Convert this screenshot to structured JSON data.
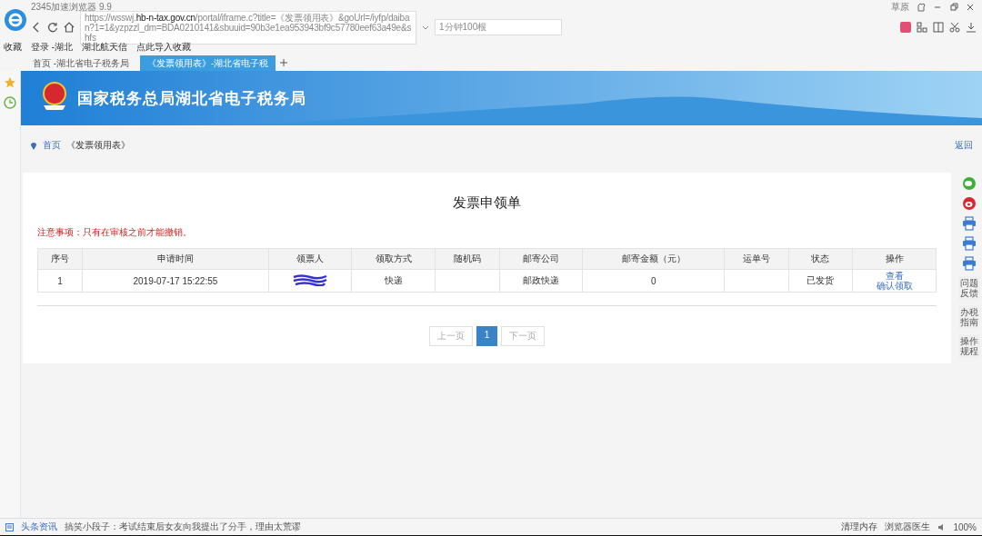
{
  "browser": {
    "title": "2345加速浏览器 9.9",
    "url_host": "https://wsswj.",
    "url_domain": "hb-n-tax.gov.cn",
    "url_rest": "/portal/iframe.c?title=《发票领用表》&goUrl=/iyfp/daiban?1=1&yzpzzl_dm=BDA0210141&sbuuid=90b3e1ea953943bf9c57780eef63a49e&shfs",
    "search_value": "1分钟100根",
    "top_link": "草原"
  },
  "bookmarks": [
    "收藏",
    "登录 -湖北",
    "湖北航天信",
    "点此导入收藏"
  ],
  "tabs": [
    {
      "label": "首页 -湖北省电子税务局",
      "selected": false
    },
    {
      "label": "《发票领用表》-湖北省电子税",
      "selected": true
    }
  ],
  "banner": {
    "title": "国家税务总局湖北省电子税务局"
  },
  "breadcrumb": {
    "home": "首页",
    "current": "《发票领用表》",
    "back": "返回"
  },
  "page_title": "发票申领单",
  "notice": "注意事项：只有在审核之前才能撤销。",
  "table": {
    "columns": [
      "序号",
      "申请时间",
      "领票人",
      "领取方式",
      "随机码",
      "邮寄公司",
      "邮寄金额（元）",
      "运单号",
      "状态",
      "操作"
    ],
    "rows": [
      {
        "cells": [
          "1",
          "2019-07-17 15:22:55",
          "",
          "快递",
          "",
          "邮政快递",
          "0",
          "",
          "已发货"
        ],
        "actions": [
          "查看",
          "确认领取"
        ]
      }
    ]
  },
  "pagination": [
    {
      "label": "上一页",
      "selected": false
    },
    {
      "label": "1",
      "selected": true
    },
    {
      "label": "下一页",
      "selected": false
    }
  ],
  "side_tools": [
    {
      "kind": "wechat"
    },
    {
      "kind": "weibo"
    },
    {
      "kind": "print"
    },
    {
      "kind": "print"
    },
    {
      "kind": "print"
    },
    {
      "kind": "text",
      "label": "问题反馈"
    },
    {
      "kind": "text",
      "label": "办税指南"
    },
    {
      "kind": "text",
      "label": "操作规程"
    }
  ],
  "status_bar": {
    "news_label": "头条资讯",
    "news": "搞笑小段子：考试结束后女友向我提出了分手，理由太荒谬",
    "clean": "清理内存",
    "doctor": "浏览器医生",
    "zoom": "100%"
  }
}
